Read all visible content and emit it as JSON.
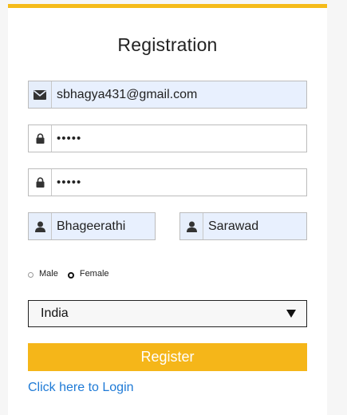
{
  "form": {
    "title": "Registration",
    "email": {
      "value": "sbhagya431@gmail.com"
    },
    "password": {
      "value": "•••••"
    },
    "confirm_password": {
      "value": "•••••"
    },
    "first_name": {
      "value": "Bhageerathi"
    },
    "last_name": {
      "value": "Sarawad"
    },
    "gender": {
      "options": [
        "Male",
        "Female"
      ],
      "selected": "Female"
    },
    "country": {
      "selected": "India"
    },
    "register_label": "Register",
    "login_link": "Click here to Login"
  },
  "colors": {
    "accent": "#f5b619",
    "link": "#1e7ad6",
    "autofill": "#e8f0fe"
  }
}
